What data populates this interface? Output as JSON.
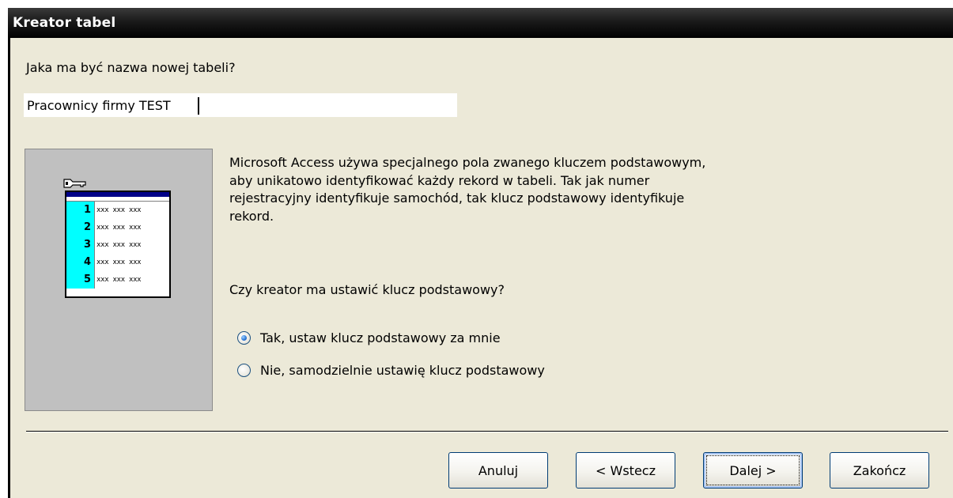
{
  "window": {
    "title": "Kreator tabel"
  },
  "name_prompt": "Jaka ma być nazwa nowej tabeli?",
  "name_input": {
    "value": "Pracownicy firmy TEST"
  },
  "illustration": {
    "key_icon": "key-icon",
    "rows": [
      {
        "num": "1",
        "text": "xxx xxx xxx"
      },
      {
        "num": "2",
        "text": "xxx xxx xxx"
      },
      {
        "num": "3",
        "text": "xxx xxx xxx"
      },
      {
        "num": "4",
        "text": "xxx xxx xxx"
      },
      {
        "num": "5",
        "text": "xxx xxx xxx"
      }
    ],
    "colors": {
      "panel": "#C0C0C0",
      "key_column": "#00FFFF",
      "header": "#000088"
    }
  },
  "description": "Microsoft Access używa specjalnego pola zwanego kluczem podstawowym, aby unikatowo identyfikować każdy rekord w tabeli. Tak jak numer rejestracyjny identyfikuje samochód, tak klucz podstawowy identyfikuje rekord.",
  "primary_key_prompt": "Czy kreator ma ustawić klucz podstawowy?",
  "options": [
    {
      "label": "Tak, ustaw klucz podstawowy za mnie",
      "selected": true
    },
    {
      "label": "Nie, samodzielnie ustawię klucz podstawowy",
      "selected": false
    }
  ],
  "buttons": {
    "cancel": "Anuluj",
    "back": "< Wstecz",
    "next": "Dalej >",
    "finish": "Zakończ"
  }
}
